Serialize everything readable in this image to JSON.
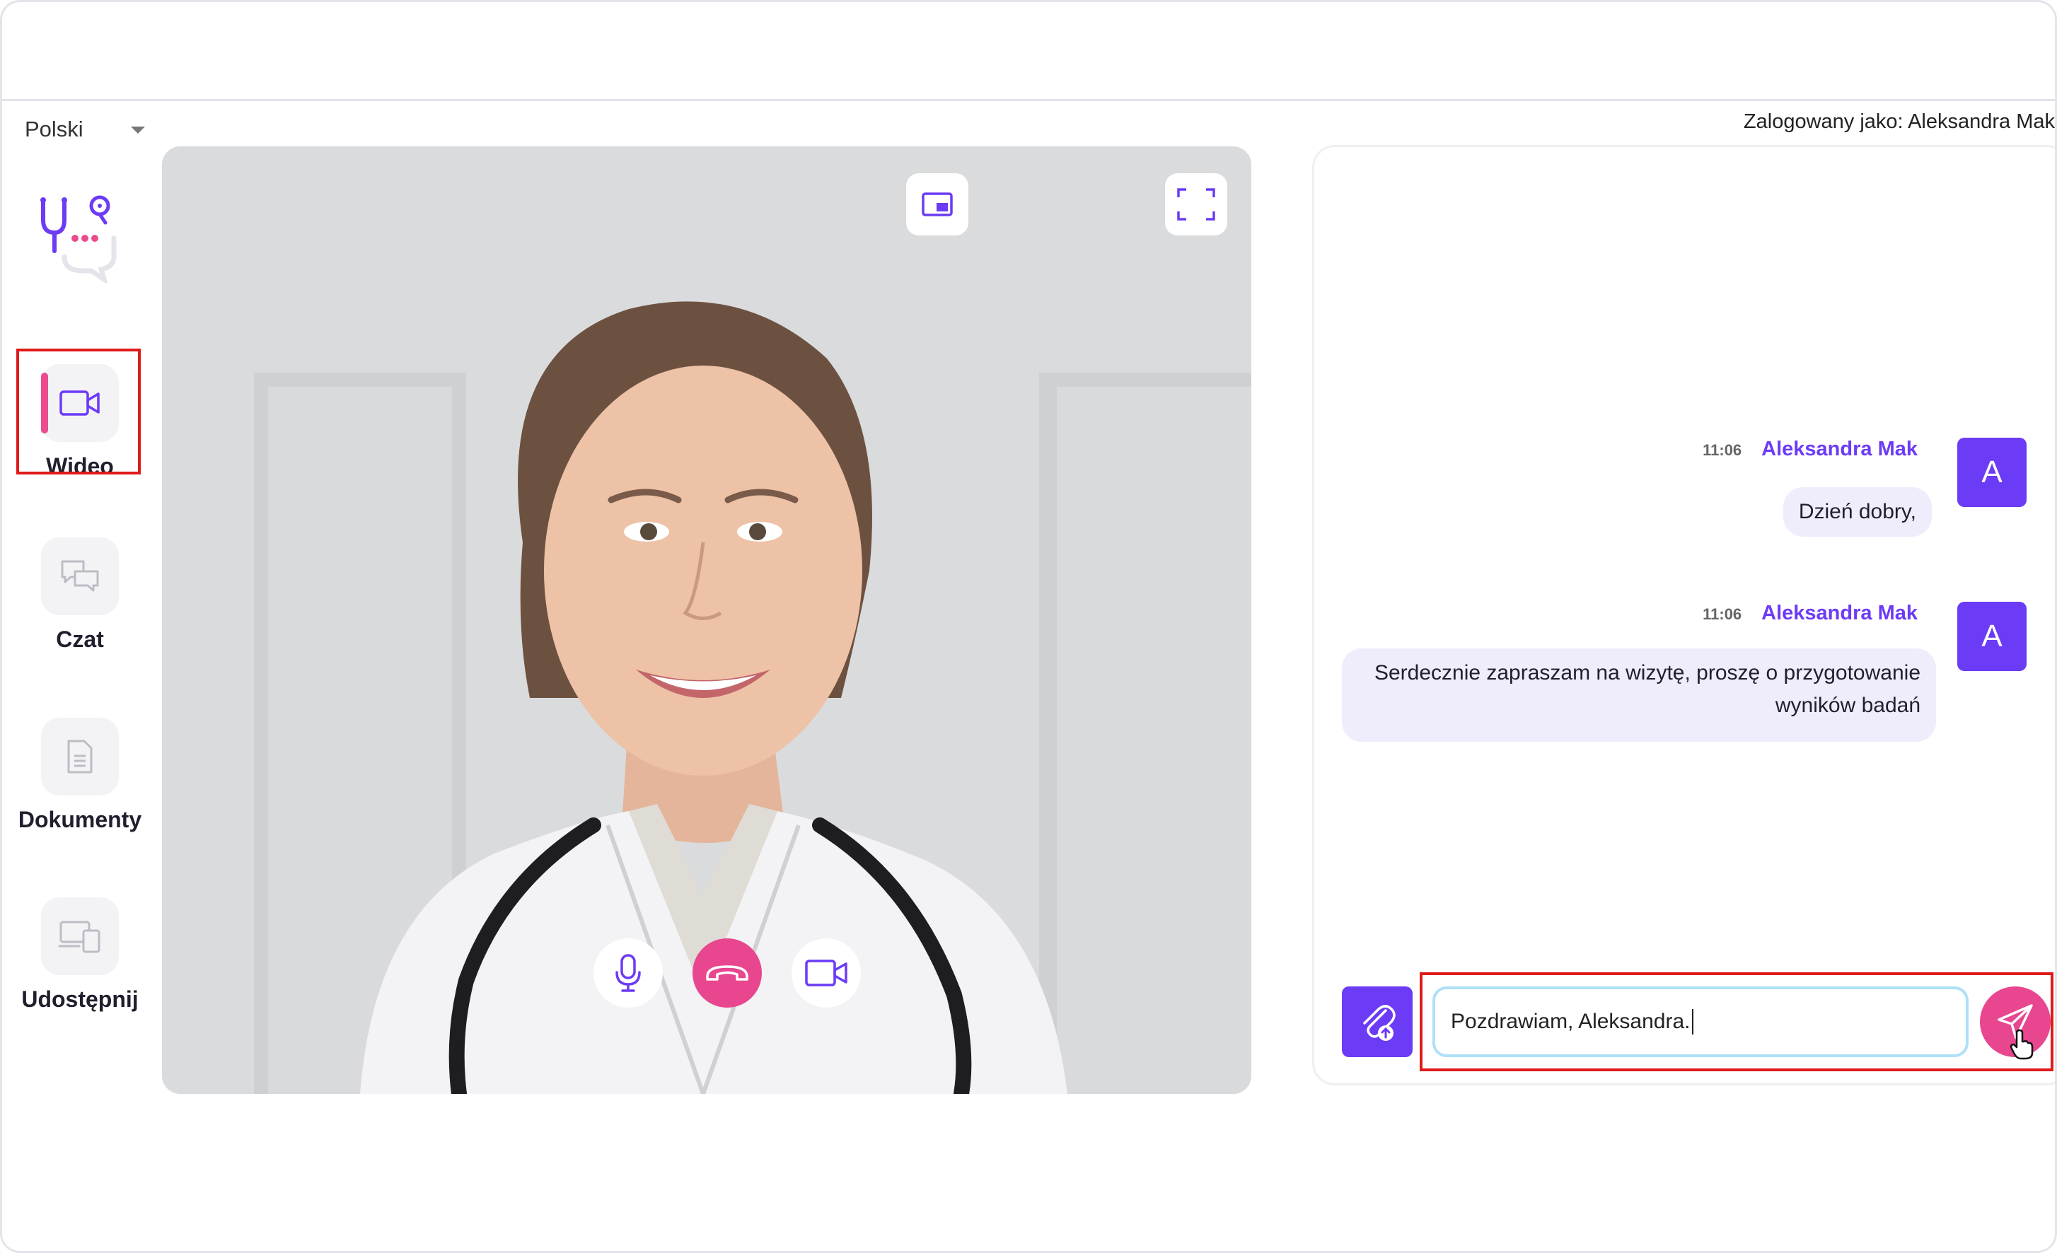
{
  "header": {
    "language": "Polski",
    "logged_in_as": "Zalogowany jako: Aleksandra Mak"
  },
  "sidebar": {
    "items": [
      {
        "label": "Wideo",
        "icon": "video-camera-icon",
        "active": true
      },
      {
        "label": "Czat",
        "icon": "chat-bubbles-icon",
        "active": false
      },
      {
        "label": "Dokumenty",
        "icon": "document-icon",
        "active": false
      },
      {
        "label": "Udostępnij",
        "icon": "share-screen-icon",
        "active": false
      }
    ]
  },
  "video": {
    "top_buttons": [
      "picture-in-picture-icon",
      "fullscreen-icon"
    ],
    "controls": [
      "microphone-icon",
      "hang-up-icon",
      "camera-icon"
    ]
  },
  "chat": {
    "messages": [
      {
        "time": "11:06",
        "author": "Aleksandra Mak",
        "avatar": "A",
        "text_lines": [
          "Dzień dobry,"
        ]
      },
      {
        "time": "11:06",
        "author": "Aleksandra Mak",
        "avatar": "A",
        "text_lines": [
          "Serdecznie zapraszam na wizytę, proszę o przygotowanie",
          "wyników badań"
        ]
      }
    ],
    "input_value": "Pozdrawiam, Aleksandra."
  },
  "colors": {
    "accent_purple": "#6c3bf5",
    "accent_pink": "#e8468f",
    "highlight_red": "#e01a1a",
    "bubble_bg": "#efedfb"
  }
}
